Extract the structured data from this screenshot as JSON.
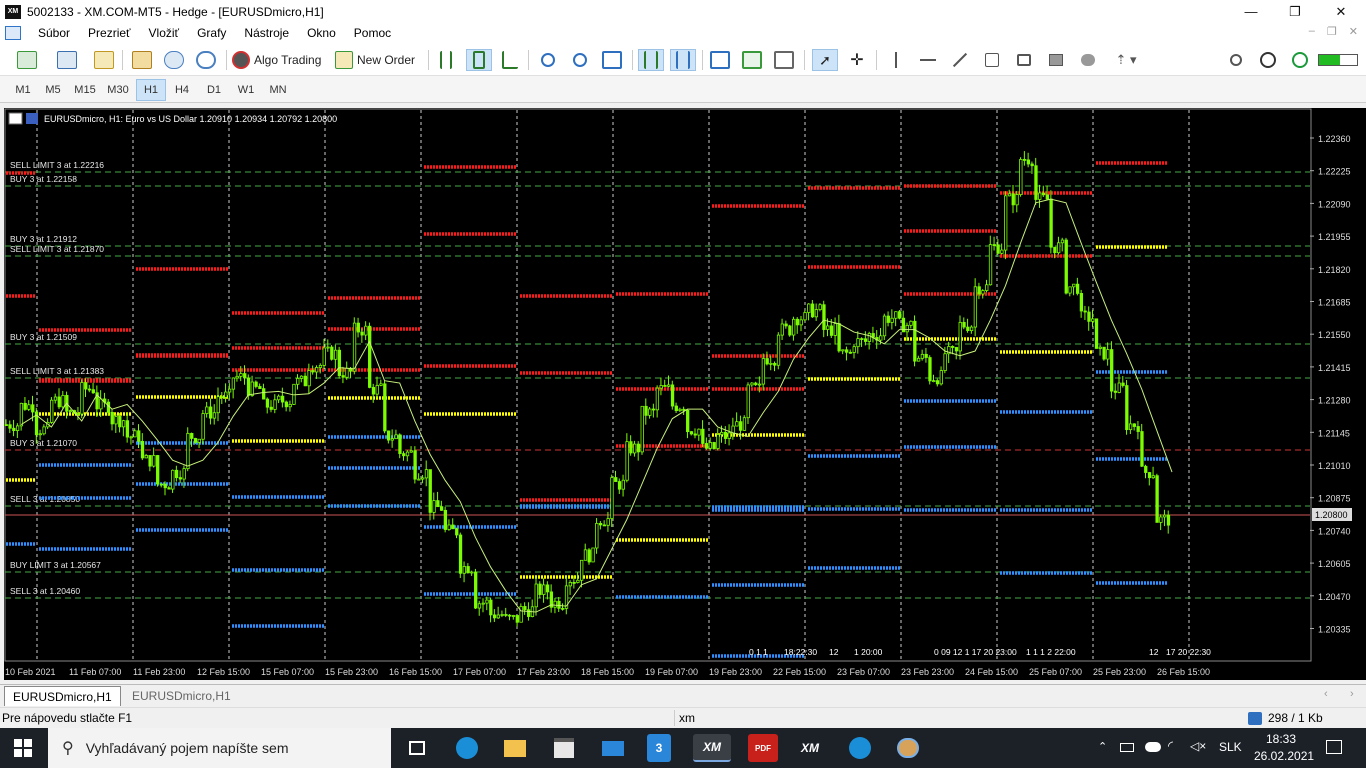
{
  "window": {
    "title": "5002133 - XM.COM-MT5 - Hedge - [EURUSDmicro,H1]",
    "app_icon_text": "XM",
    "minimize": "—",
    "maximize": "❐",
    "close": "✕"
  },
  "menu": {
    "items": [
      "Súbor",
      "Prezrieť",
      "Vložiť",
      "Grafy",
      "Nástroje",
      "Okno",
      "Pomoc"
    ],
    "mdi_controls": [
      "–",
      "❐",
      "✕"
    ]
  },
  "toolbar": {
    "algo_trading": "Algo Trading",
    "new_order": "New Order",
    "icons": [
      "new-chart-icon",
      "profiles-icon",
      "market-watch-icon",
      "navigator-icon",
      "data-window-icon",
      "signals-icon",
      "algo-trading-icon",
      "new-order-icon",
      "bar-chart-icon",
      "candlestick-icon",
      "line-chart-icon",
      "zoom-in-icon",
      "zoom-out-icon",
      "tile-windows-icon",
      "auto-scroll-icon",
      "chart-shift-icon",
      "indicators-icon",
      "templates-icon",
      "periods-icon",
      "cursor-icon",
      "crosshair-icon",
      "vertical-line-icon",
      "horizontal-line-icon",
      "trend-line-icon",
      "text-icon",
      "text-label-icon",
      "rectangle-icon",
      "ellipse-icon",
      "arrows-icon",
      "search-icon",
      "account-icon",
      "level-icon",
      "signal-strength-icon"
    ]
  },
  "timeframes": {
    "items": [
      "M1",
      "M5",
      "M15",
      "M30",
      "H1",
      "H4",
      "D1",
      "W1",
      "MN"
    ],
    "active": "H1"
  },
  "chart": {
    "header": "EURUSDmicro, H1:  Euro vs US Dollar  1.20910 1.20934 1.20792 1.20800",
    "current_price": "1.20800",
    "price_axis": [
      "1.22360",
      "1.22225",
      "1.22090",
      "1.21955",
      "1.21820",
      "1.21685",
      "1.21550",
      "1.21415",
      "1.21280",
      "1.21145",
      "1.21010",
      "1.20875",
      "1.20740",
      "1.20605",
      "1.20470",
      "1.20335"
    ],
    "time_axis": [
      "10 Feb 2021",
      "11 Feb 07:00",
      "11 Feb 23:00",
      "12 Feb 15:00",
      "15 Feb 07:00",
      "15 Feb 23:00",
      "16 Feb 15:00",
      "17 Feb 07:00",
      "17 Feb 23:00",
      "18 Feb 15:00",
      "19 Feb 07:00",
      "19 Feb 23:00",
      "22 Feb 15:00",
      "23 Feb 07:00",
      "23 Feb 23:00",
      "24 Feb 15:00",
      "25 Feb 07:00",
      "25 Feb 23:00",
      "26 Feb 15:00"
    ],
    "order_labels": [
      "SELL LIMIT 3 at 1.22216",
      "BUY 3 at 1.22158",
      "BUY 3 at 1.21912",
      "SELL LIMIT 3 at 1.21870",
      "BUY 3 at 1.21509",
      "SELL LIMIT 3 at 1.21383",
      "BUY 3 at 1.21070",
      "SELL 3 at 1.20850",
      "BUY LIMIT 3 at 1.20567",
      "SELL 3 at 1.20460"
    ],
    "bottom_labels": [
      "0 1 1",
      "18:22:30",
      "12",
      "1 20:00",
      "0 09 12 1 17 20 23:00",
      "1 1 1 2 22:00",
      "12",
      "17 20 22:30"
    ],
    "colors": {
      "candle": "#7cfc00",
      "ma": "#c8f07a",
      "red": "#ff1a1a",
      "yellow": "#ffff00",
      "blue": "#2f8fff",
      "grid": "#ffffff",
      "level_line": "#44aa44"
    }
  },
  "chart_data": {
    "type": "candlestick",
    "symbol": "EURUSDmicro",
    "timeframe": "H1",
    "ohlc_last": {
      "open": 1.2091,
      "high": 1.20934,
      "low": 1.20792,
      "close": 1.208
    },
    "ylim": [
      1.2025,
      1.2245
    ],
    "close_path": [
      1.212,
      1.2128,
      1.2118,
      1.213,
      1.2125,
      1.2135,
      1.2128,
      1.2122,
      1.2115,
      1.2105,
      1.2095,
      1.21,
      1.2115,
      1.2125,
      1.2132,
      1.214,
      1.2135,
      1.2128,
      1.213,
      1.2138,
      1.2145,
      1.215,
      1.2142,
      1.216,
      1.2135,
      1.2115,
      1.2108,
      1.21,
      1.2085,
      1.2075,
      1.206,
      1.2045,
      1.204,
      1.2038,
      1.2042,
      1.205,
      1.2045,
      1.2055,
      1.2065,
      1.208,
      1.2095,
      1.211,
      1.2125,
      1.2135,
      1.2128,
      1.2118,
      1.211,
      1.2115,
      1.212,
      1.2135,
      1.2148,
      1.216,
      1.2165,
      1.2168,
      1.216,
      1.215,
      1.2155,
      1.2158,
      1.2165,
      1.2162,
      1.2148,
      1.214,
      1.215,
      1.2162,
      1.2178,
      1.2195,
      1.2215,
      1.2232,
      1.2215,
      1.2195,
      1.2178,
      1.2165,
      1.215,
      1.2135,
      1.212,
      1.21,
      1.208
    ]
  },
  "bottom_tabs": [
    "EURUSDmicro,H1",
    "EURUSDmicro,H1"
  ],
  "status": {
    "help": "Pre nápovedu stlačte F1",
    "profile": "xm",
    "traffic": "298 / 1 Kb"
  },
  "taskbar": {
    "search_placeholder": "Vyhľadávaný pojem napíšte sem",
    "time": "18:33",
    "date": "26.02.2021",
    "lang": "SLK",
    "apps": [
      "task-view",
      "edge",
      "file-explorer",
      "store",
      "mail",
      "app-3",
      "xm-mt5",
      "pdf",
      "xm-mt5-2",
      "edge-2",
      "paint"
    ],
    "app_xm_label": "XM",
    "app_3_label": "3",
    "app_pdf_label": "PDF"
  }
}
